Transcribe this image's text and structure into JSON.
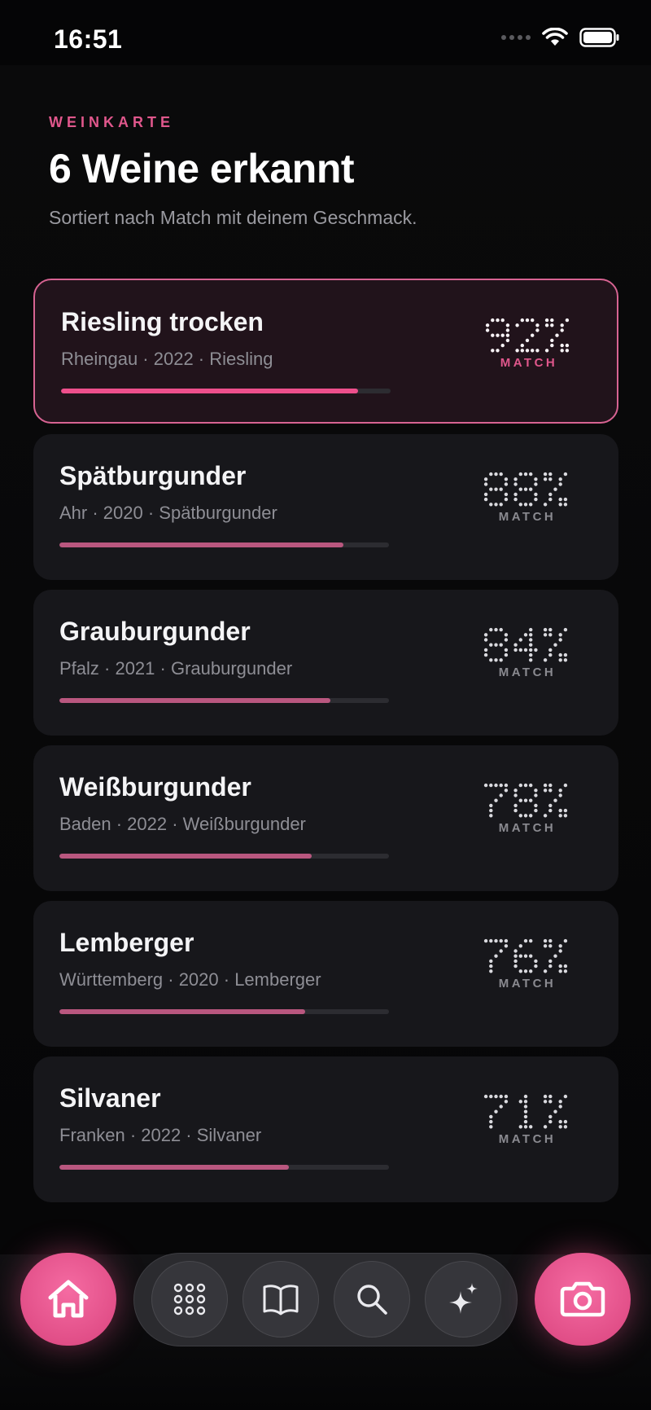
{
  "status": {
    "time": "16:51"
  },
  "header": {
    "eyebrow": "WEINKARTE",
    "title": "6 Weine erkannt",
    "subtitle": "Sortiert nach Match mit deinem Geschmack."
  },
  "wines": [
    {
      "name": "Riesling trocken",
      "meta": "Rheingau · 2022 · Riesling",
      "score": "92%",
      "score_value": 92,
      "match_label": "MATCH",
      "selected": true
    },
    {
      "name": "Spätburgunder",
      "meta": "Ahr · 2020 · Spätburgunder",
      "score": "88%",
      "score_value": 88,
      "match_label": "MATCH",
      "selected": false
    },
    {
      "name": "Grauburgunder",
      "meta": "Pfalz · 2021 · Grauburgunder",
      "score": "84%",
      "score_value": 84,
      "match_label": "MATCH",
      "selected": false
    },
    {
      "name": "Weißburgunder",
      "meta": "Baden · 2022 · Weißburgunder",
      "score": "78%",
      "score_value": 78,
      "match_label": "MATCH",
      "selected": false
    },
    {
      "name": "Lemberger",
      "meta": "Württemberg · 2020 · Lemberger",
      "score": "76%",
      "score_value": 76,
      "match_label": "MATCH",
      "selected": false
    },
    {
      "name": "Silvaner",
      "meta": "Franken · 2022 · Silvaner",
      "score": "71%",
      "score_value": 71,
      "match_label": "MATCH",
      "selected": false
    }
  ],
  "tabbar": {
    "left": "home-icon",
    "items": [
      "grid-icon",
      "book-icon",
      "search-icon",
      "sparkle-icon"
    ],
    "right": "camera-icon"
  },
  "colors": {
    "accent": "#e0578c",
    "selected_border": "#d76392",
    "card_bg": "#17171b",
    "bar_fill": "#b9577f",
    "bar_fill_selected": "#ee4f8c"
  }
}
